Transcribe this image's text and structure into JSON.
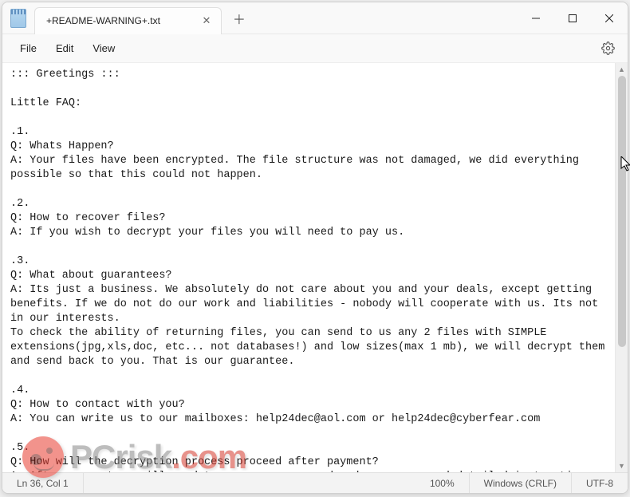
{
  "tab": {
    "title": "+README-WARNING+.txt"
  },
  "menu": {
    "file": "File",
    "edit": "Edit",
    "view": "View"
  },
  "document": {
    "text": "::: Greetings :::\n\nLittle FAQ:\n\n.1.\nQ: Whats Happen?\nA: Your files have been encrypted. The file structure was not damaged, we did everything possible so that this could not happen.\n\n.2.\nQ: How to recover files?\nA: If you wish to decrypt your files you will need to pay us.\n\n.3.\nQ: What about guarantees?\nA: Its just a business. We absolutely do not care about you and your deals, except getting benefits. If we do not do our work and liabilities - nobody will cooperate with us. Its not in our interests.\nTo check the ability of returning files, you can send to us any 2 files with SIMPLE extensions(jpg,xls,doc, etc... not databases!) and low sizes(max 1 mb), we will decrypt them and send back to you. That is our guarantee.\n\n.4.\nQ: How to contact with you?\nA: You can write us to our mailboxes: help24dec@aol.com or help24dec@cyberfear.com\n\n.5.\nQ: How will the decryption process proceed after payment?\nA: After payment we will send to you our scanner-decoder program and detailed instructions for use. With this program you will be able to decrypt all your encrypted files."
  },
  "status": {
    "position": "Ln 36, Col 1",
    "zoom": "100%",
    "lineending": "Windows (CRLF)",
    "encoding": "UTF-8"
  },
  "watermark": {
    "brand": "PCrisk",
    "tld": ".com"
  }
}
